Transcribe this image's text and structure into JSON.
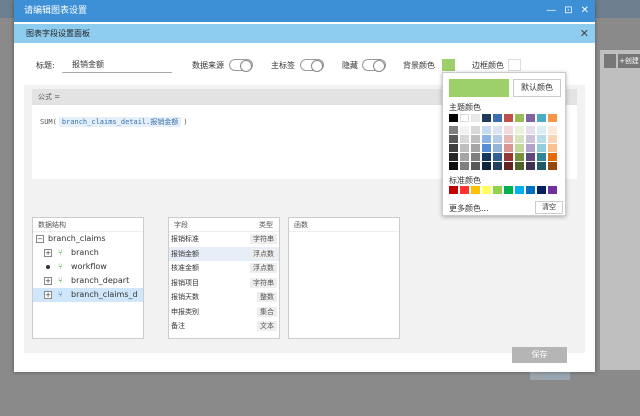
{
  "outer_window": {
    "title": "请编辑图表设置",
    "controls": [
      "—",
      "⊡",
      "✕"
    ]
  },
  "dialog": {
    "title": "图表字段设置面板",
    "close": "✕"
  },
  "toolbar": {
    "title_label": "标题:",
    "title_value": "报销金额",
    "data_source_label": "数据来源",
    "main_tag_label": "主标签",
    "hidden_label": "隐藏",
    "bg_color_label": "背景颜色",
    "border_color_label": "边框颜色",
    "bg_color": "#9ed06a",
    "border_color": "#ffffff"
  },
  "formula": {
    "header": "公式 =",
    "func": "SUM(",
    "field": "branch_claims_detail.报销金额",
    "close": ")"
  },
  "data_structure": {
    "header": "数据结构",
    "root": "branch_claims",
    "items": [
      {
        "label": "branch",
        "icon": "expand"
      },
      {
        "label": "workflow",
        "icon": "dot"
      },
      {
        "label": "branch_depart",
        "icon": "expand"
      },
      {
        "label": "branch_claims_d",
        "icon": "expand"
      }
    ]
  },
  "fields": {
    "header_name": "字段",
    "header_type": "类型",
    "rows": [
      {
        "name": "报销标准",
        "type": "字符串"
      },
      {
        "name": "报销金额",
        "type": "浮点数"
      },
      {
        "name": "核准金额",
        "type": "浮点数"
      },
      {
        "name": "报销项目",
        "type": "字符串"
      },
      {
        "name": "报销天数",
        "type": "整数"
      },
      {
        "name": "申报类别",
        "type": "集合"
      },
      {
        "name": "备注",
        "type": "文本"
      }
    ]
  },
  "functions": {
    "header": "函数"
  },
  "save_label": "保存",
  "color_picker": {
    "current": "#9ed06a",
    "default_label": "默认颜色",
    "theme_label": "主题颜色",
    "standard_label": "标准颜色",
    "more_label": "更多颜色...",
    "clear_label": "清空",
    "theme_top": [
      "#000000",
      "#ffffff",
      "#e8e8e8",
      "#1f3b5c",
      "#3d6fb0",
      "#c0504d",
      "#9bbb59",
      "#8064a2",
      "#4bacc6",
      "#f79646"
    ],
    "theme_shades": [
      [
        "#7f7f7f",
        "#f2f2f2",
        "#d8d8d8",
        "#c6d9f0",
        "#dbe5f1",
        "#f2dcdb",
        "#ebf1dd",
        "#e5e0ec",
        "#dbeef3",
        "#fdeada"
      ],
      [
        "#595959",
        "#d8d8d8",
        "#bfbfbf",
        "#8db3e2",
        "#b8cce4",
        "#e5b9b7",
        "#d7e3bc",
        "#ccc1d9",
        "#b7dde8",
        "#fbd5b5"
      ],
      [
        "#3f3f3f",
        "#bfbfbf",
        "#a5a5a5",
        "#548dd4",
        "#95b3d7",
        "#d99694",
        "#c3d69b",
        "#b2a2c7",
        "#92cddc",
        "#fac08f"
      ],
      [
        "#262626",
        "#a5a5a5",
        "#7f7f7f",
        "#17365d",
        "#366092",
        "#953734",
        "#76923c",
        "#5f497a",
        "#31859b",
        "#e36c09"
      ],
      [
        "#0c0c0c",
        "#7f7f7f",
        "#595959",
        "#0f243e",
        "#244061",
        "#632423",
        "#4f6128",
        "#3f3151",
        "#205867",
        "#974806"
      ]
    ],
    "standard": [
      "#c00000",
      "#ff3030",
      "#ffc000",
      "#ffff60",
      "#92d050",
      "#00b050",
      "#00b0f0",
      "#0070c0",
      "#002060",
      "#7030a0"
    ]
  },
  "background": {
    "right_button": "+创建"
  }
}
